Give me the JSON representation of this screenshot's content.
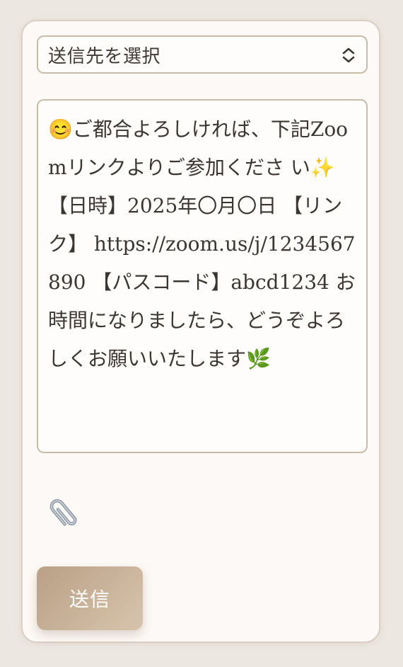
{
  "recipient_select": {
    "selected_label": "送信先を選択",
    "icon": "chevron-up-down-icon"
  },
  "message": {
    "text": "😊ご都合よろしければ、下記Zoomリンクよりご参加くださ い✨ 【日時】2025年〇月〇日 【リンク】 https://zoom.us/j/1234567890 【パスコード】abcd1234 お時間になりましたら、どうぞよろしくお願いいたします🌿"
  },
  "attachment": {
    "icon": "paperclip-icon"
  },
  "send_button": {
    "label": "送信"
  },
  "colors": {
    "page_background": "#ede7e1",
    "card_background": "#fdf9f6",
    "field_border": "#c8bca6",
    "button_gradient_start": "#b9a086",
    "button_gradient_end": "#d8c4ad"
  }
}
